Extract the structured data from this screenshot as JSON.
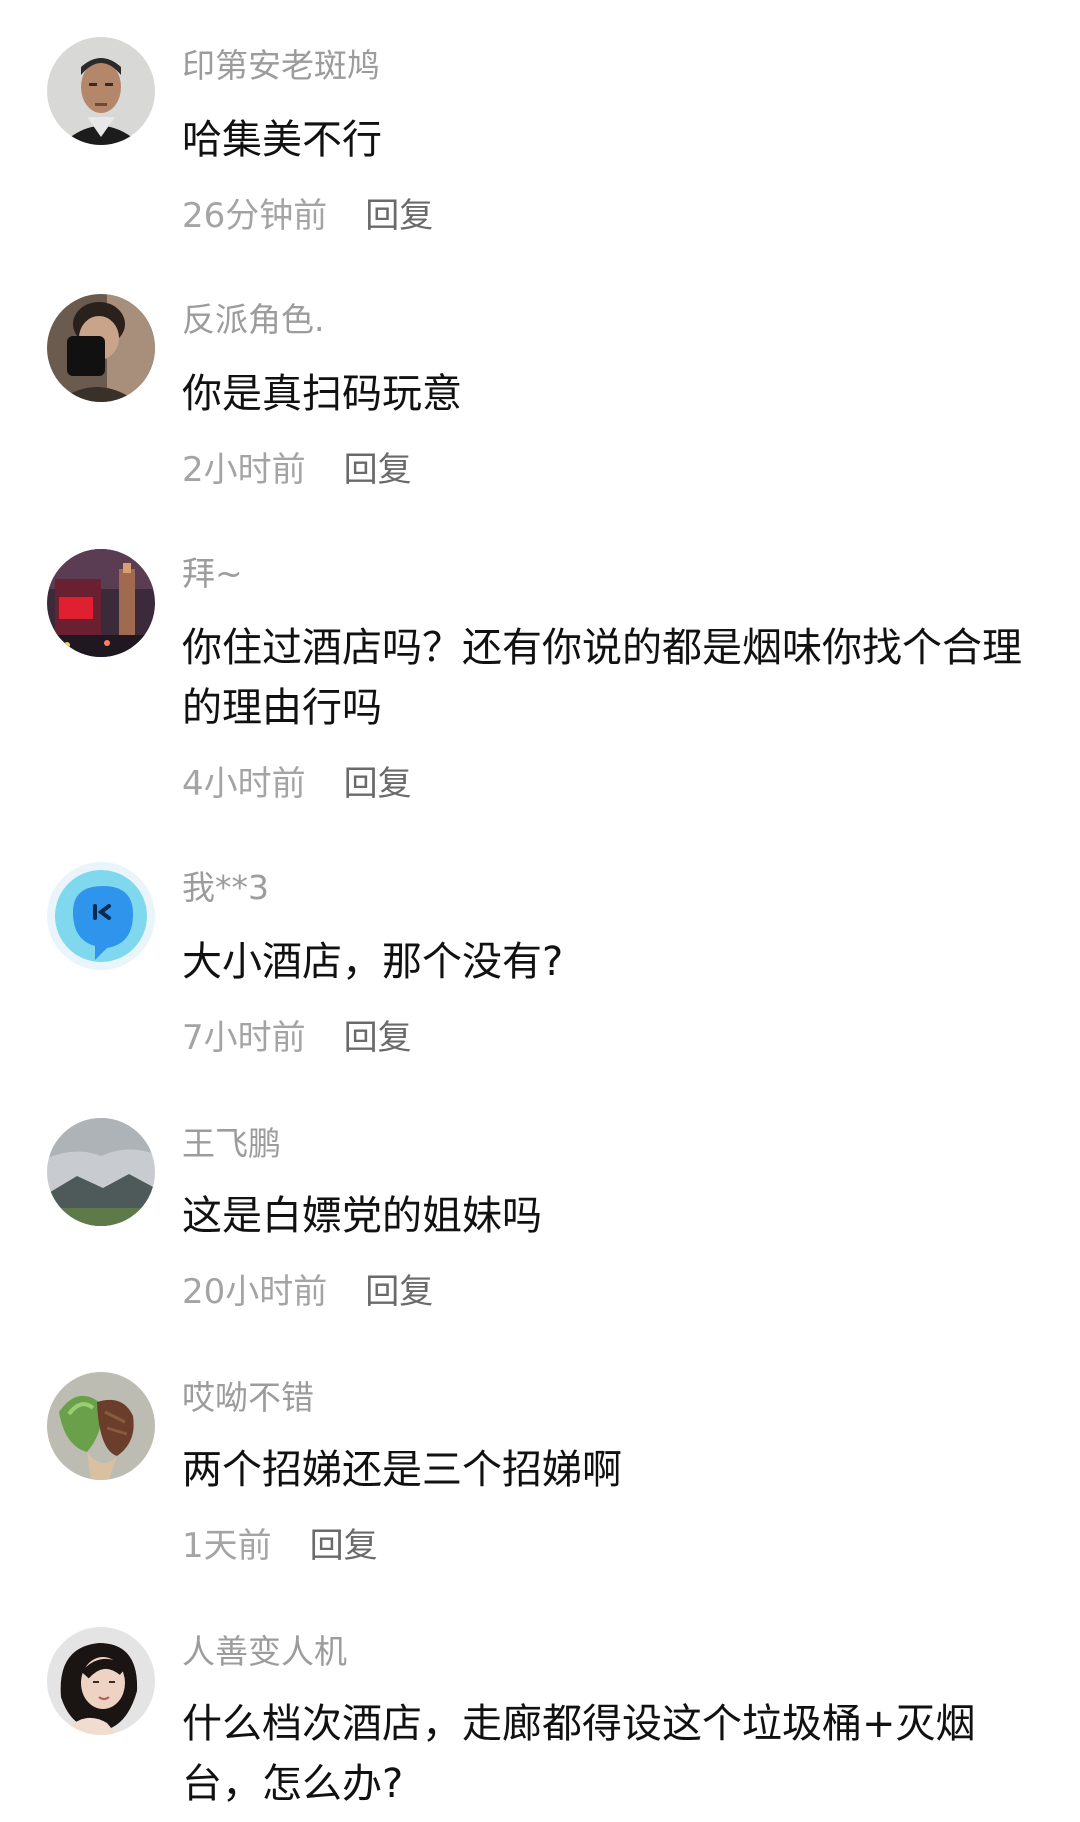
{
  "comments": [
    {
      "user": "印第安老斑鸠",
      "text": "哈集美不行",
      "time": "26分钟前",
      "reply": "回复",
      "avatar_icon": "avatar-man-portrait"
    },
    {
      "user": "反派角色.",
      "text": "你是真扫码玩意",
      "time": "2小时前",
      "reply": "回复",
      "avatar_icon": "avatar-mirror-selfie"
    },
    {
      "user": "拜~",
      "text": "你住过酒店吗？还有你说的都是烟味你找个合理的理由行吗",
      "time": "4小时前",
      "reply": "回复",
      "avatar_icon": "avatar-night-city"
    },
    {
      "user": "我**3",
      "text": "大小酒店，那个没有?",
      "time": "7小时前",
      "reply": "回复",
      "avatar_icon": "avatar-blue-blob"
    },
    {
      "user": "王飞鹏",
      "text": "这是白嫖党的姐妹吗",
      "time": "20小时前",
      "reply": "回复",
      "avatar_icon": "avatar-mountain-landscape"
    },
    {
      "user": "哎呦不错",
      "text": "两个招娣还是三个招娣啊",
      "time": "1天前",
      "reply": "回复",
      "avatar_icon": "avatar-food"
    },
    {
      "user": "人善变人机",
      "text": "什么档次酒店，走廊都得设这个垃圾桶+灭烟台，怎么办?",
      "time": "",
      "reply": "",
      "avatar_icon": "avatar-woman-portrait"
    }
  ],
  "colors": {
    "username": "#9c9c9c",
    "content": "#111111",
    "time": "#a4a4a4",
    "reply": "#6a6a6a",
    "background": "#ffffff"
  }
}
